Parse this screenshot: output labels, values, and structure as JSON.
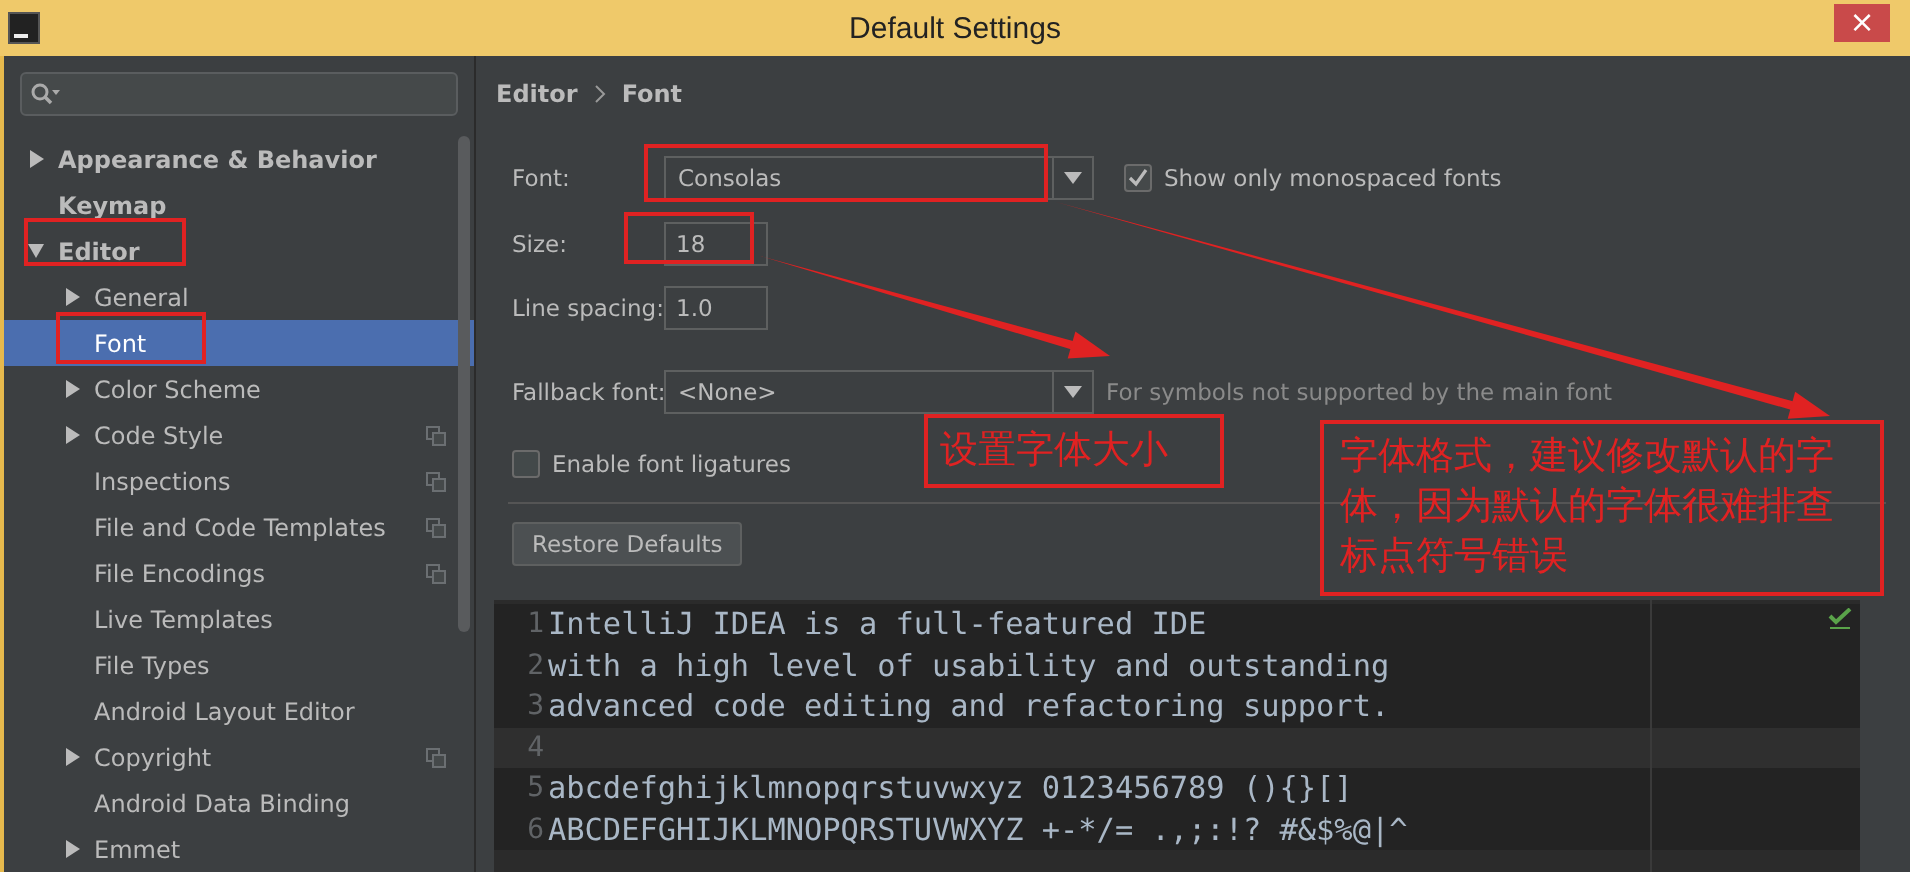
{
  "window": {
    "title": "Default Settings",
    "close": "×"
  },
  "sidebar": {
    "items": [
      {
        "label": "Appearance & Behavior",
        "expanded": false,
        "bold": true,
        "selected": false
      },
      {
        "label": "Keymap",
        "bold": true,
        "selected": false
      },
      {
        "label": "Editor",
        "expanded": true,
        "bold": true,
        "selected": false,
        "children": [
          {
            "label": "General",
            "expanded": false,
            "selected": false
          },
          {
            "label": "Font",
            "selected": true
          },
          {
            "label": "Color Scheme",
            "expanded": false,
            "selected": false
          },
          {
            "label": "Code Style",
            "expanded": false,
            "per_project": true,
            "selected": false
          },
          {
            "label": "Inspections",
            "per_project": true,
            "selected": false
          },
          {
            "label": "File and Code Templates",
            "per_project": true,
            "selected": false
          },
          {
            "label": "File Encodings",
            "per_project": true,
            "selected": false
          },
          {
            "label": "Live Templates",
            "selected": false
          },
          {
            "label": "File Types",
            "selected": false
          },
          {
            "label": "Android Layout Editor",
            "selected": false
          },
          {
            "label": "Copyright",
            "expanded": false,
            "per_project": true,
            "selected": false
          },
          {
            "label": "Android Data Binding",
            "selected": false
          },
          {
            "label": "Emmet",
            "expanded": false,
            "selected": false
          }
        ]
      }
    ]
  },
  "breadcrumb": [
    "Editor",
    "Font"
  ],
  "settings": {
    "font_label": "Font:",
    "font_value": "Consolas",
    "monospaced": {
      "label": "Show only monospaced fonts",
      "checked": true
    },
    "size_label": "Size:",
    "size_value": "18",
    "spacing_label": "Line spacing:",
    "spacing_value": "1.0",
    "fallback_label": "Fallback font:",
    "fallback_value": "<None>",
    "fallback_hint": "For symbols not supported by the main font",
    "ligatures": {
      "label": "Enable font ligatures",
      "checked": false
    },
    "restore_button": "Restore Defaults"
  },
  "preview": {
    "lines": [
      {
        "number": "1",
        "text": "IntelliJ IDEA is a full-featured IDE"
      },
      {
        "number": "2",
        "text": "with a high level of usability and outstanding"
      },
      {
        "number": "3",
        "text": "advanced code editing and refactoring support."
      },
      {
        "number": "4"
      },
      {
        "number": "5",
        "text": "abcdefghijklmnopqrstuvwxyz 0123456789 (){}[]"
      },
      {
        "number": "6",
        "text": "ABCDEFGHIJKLMNOPQRSTUVWXYZ +-*/= .,;:!? #&$%@|^"
      }
    ]
  },
  "annotations": [
    {
      "kind": "box"
    },
    {
      "kind": "box"
    },
    {
      "kind": "box"
    },
    {
      "kind": "box"
    },
    {
      "kind": "arrow"
    },
    {
      "kind": "arrow"
    },
    {
      "kind": "note",
      "text": "设置字体大小"
    },
    {
      "kind": "note",
      "text": "字体格式，建议修改默认的字体，因为默认的字体很难排查标点符号错误"
    }
  ]
}
